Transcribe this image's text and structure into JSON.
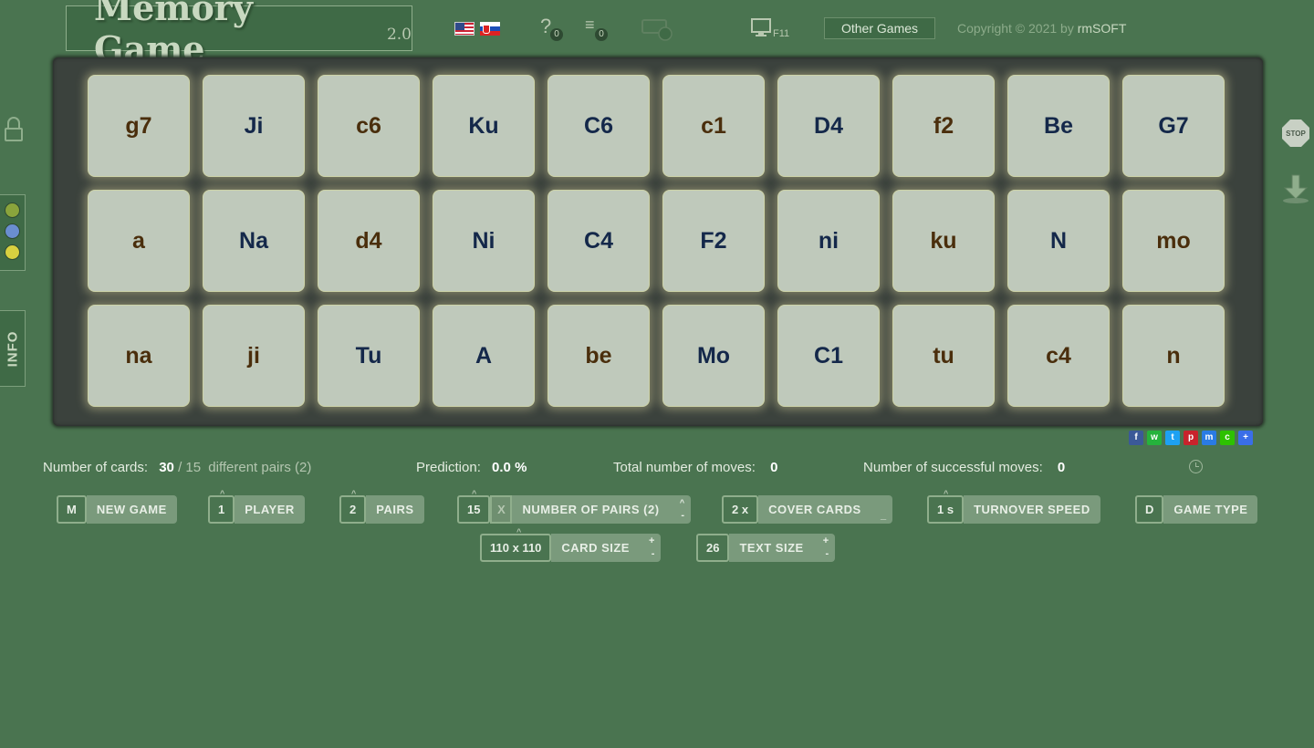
{
  "header": {
    "title": "Memory Game",
    "version": "2.0",
    "help_count": "0",
    "list_count": "0",
    "fullscreen_key": "F11",
    "other_games": "Other Games",
    "copyright": "Copyright © 2021 by",
    "author": "rmSOFT"
  },
  "cards": [
    [
      "g7",
      "Ji",
      "c6",
      "Ku",
      "C6",
      "c1",
      "D4",
      "f2",
      "Be",
      "G7"
    ],
    [
      "a",
      "Na",
      "d4",
      "Ni",
      "C4",
      "F2",
      "ni",
      "ku",
      "N",
      "mo"
    ],
    [
      "na",
      "ji",
      "Tu",
      "A",
      "be",
      "Mo",
      "C1",
      "tu",
      "c4",
      "n"
    ]
  ],
  "card_colors": [
    [
      "brown",
      "blue",
      "brown",
      "blue",
      "blue",
      "brown",
      "blue",
      "brown",
      "blue",
      "blue"
    ],
    [
      "brown",
      "blue",
      "brown",
      "blue",
      "blue",
      "blue",
      "blue",
      "brown",
      "blue",
      "brown"
    ],
    [
      "brown",
      "brown",
      "blue",
      "blue",
      "brown",
      "blue",
      "blue",
      "brown",
      "brown",
      "brown"
    ]
  ],
  "side": {
    "info": "INFO",
    "stop": "STOP",
    "colors": [
      "#8aa43c",
      "#6a8ed0",
      "#d8d040"
    ]
  },
  "share_icons": [
    "facebook-icon",
    "whatsapp-icon",
    "twitter-icon",
    "pinterest-icon",
    "messenger-icon",
    "wechat-icon",
    "more-icon"
  ],
  "stats": {
    "cards_label": "Number of cards:",
    "cards_value": "30",
    "pairs_sep": "/",
    "pairs_value": "15",
    "pairs_text": "different pairs (2)",
    "prediction_label": "Prediction:",
    "prediction_value": "0.0 %",
    "moves_label": "Total number of moves:",
    "moves_value": "0",
    "success_label": "Number of successful moves:",
    "success_value": "0"
  },
  "controls": {
    "new_game_key": "M",
    "new_game": "NEW GAME",
    "player_key": "1",
    "player": "PLAYER",
    "pairs_key": "2",
    "pairs": "PAIRS",
    "num_pairs_key": "15",
    "num_pairs_x": "X",
    "num_pairs": "NUMBER OF PAIRS (2)",
    "cover_key": "2 x",
    "cover": "COVER CARDS",
    "speed_key": "1 s",
    "speed": "TURNOVER SPEED",
    "type_key": "D",
    "type": "GAME TYPE",
    "card_size_key": "110 x 110",
    "card_size": "CARD SIZE",
    "text_size_key": "26",
    "text_size": "TEXT SIZE",
    "plus": "+",
    "minus": "-",
    "caret": "^",
    "underscore": "_"
  }
}
